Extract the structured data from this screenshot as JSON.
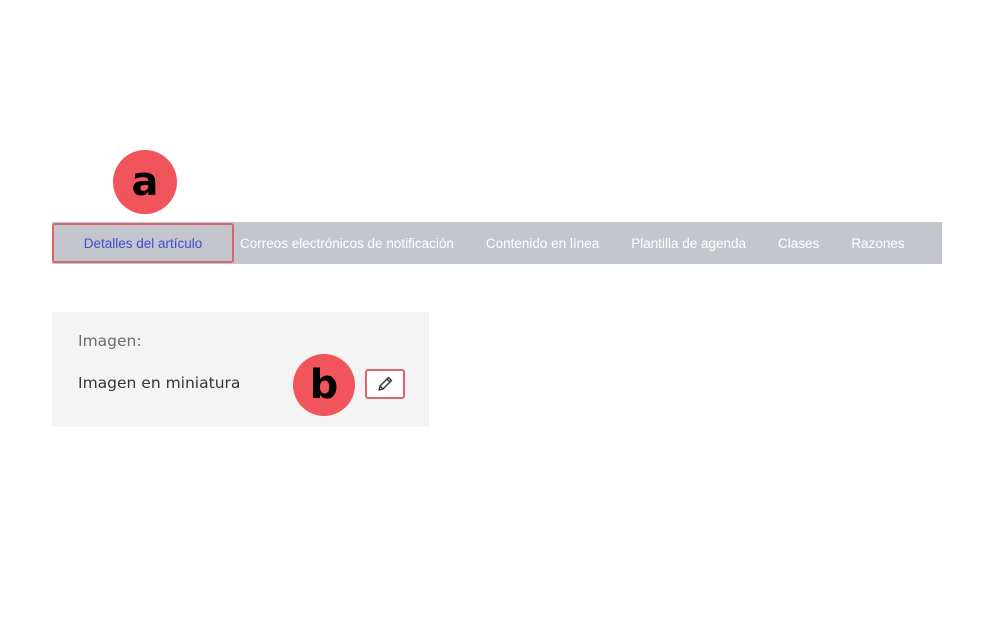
{
  "callouts": {
    "a": "a",
    "b": "b"
  },
  "tabs": [
    {
      "label": "Detalles del artículo",
      "active": true
    },
    {
      "label": "Correos electrónicos de notificación",
      "active": false
    },
    {
      "label": "Contenido en línea",
      "active": false
    },
    {
      "label": "Plantilla de agenda",
      "active": false
    },
    {
      "label": "Clases",
      "active": false
    },
    {
      "label": "Razones",
      "active": false
    }
  ],
  "image_section": {
    "label": "Imagen:",
    "value": "Imagen en miniatura",
    "edit_icon": "pencil-icon"
  },
  "colors": {
    "callout": "#f2545b",
    "tabbar_bg": "#c3c6cc",
    "active_tab_text": "#3d4fd1",
    "highlight_border": "#d9666a"
  }
}
